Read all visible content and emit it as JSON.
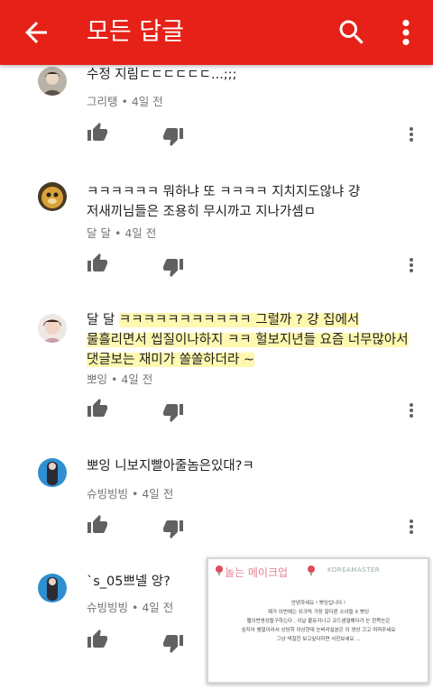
{
  "appbar": {
    "title": "모든 답글",
    "icons": {
      "back": "arrow-back-icon",
      "search": "search-icon",
      "more": "more-vert-icon"
    }
  },
  "colors": {
    "brand": "#e62117",
    "highlight": "#fff596"
  },
  "comments": [
    {
      "text": "수정 지림ㄷㄷㄷㄷㄷㄷ...;;;",
      "author": "그리탱",
      "time": "4일 전"
    },
    {
      "line1": "ㅋㅋㅋㅋㅋㅋ 뭐하냐 또 ㅋㅋㅋㅋ 지치지도않냐 걍",
      "line2": "저새끼님들은 조용히 무시까고 지나가셈ㅁ",
      "author": "달 달",
      "time": "4일 전"
    },
    {
      "mention": "달 달",
      "line1": "ㅋㅋㅋㅋㅋㅋㅋㅋㅋㅋㅋ 그럴까 ? 걍 집에서",
      "line2": "물흘리면서 씹질이나하지 ㅋㅋ 헐보지년들 요즘 너무많아서",
      "line3": "댓글보는 재미가 쏠쏠하더라 ~",
      "author": "뽀잉",
      "time": "4일 전"
    },
    {
      "text": "뽀잉 니보지빨아줄놈은있대?ㅋ",
      "author": "슈빙빙빙",
      "time": "4일 전"
    },
    {
      "text": "`s_05쁘넬 앙?",
      "author": "슈빙빙빙",
      "time": "4일 전"
    }
  ],
  "thumbnail": {
    "title": "놀는 메이크업",
    "watermark": "KOREAMASTER",
    "lines": [
      "안녕하세요 ! 뽀잉입니다 !",
      "제가 이번에는 쉬크릭 가장 잘다른 소녀들 X 뽀잉",
      "웹이번영상들구하는다 , 이날 붙유지나고 코드샘덜해다가 눈 한쪽눈은",
      "심지어 쌩얼이라서 상당히 이상한데 눈버리실분은 이 영상 끄고 꺼져주세요",
      "그냥 색칠한 보고싶다하면 사진보세요 ..."
    ]
  }
}
